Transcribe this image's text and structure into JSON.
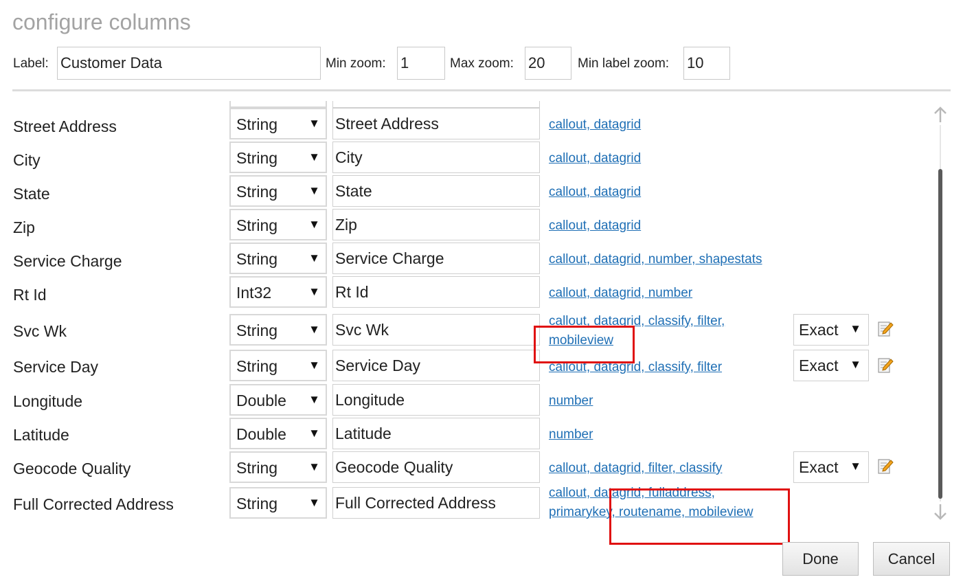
{
  "dialog": {
    "title": "configure columns"
  },
  "header": {
    "label_caption": "Label:",
    "label_value": "Customer Data",
    "min_zoom_caption": "Min zoom:",
    "min_zoom_value": "1",
    "max_zoom_caption": "Max zoom:",
    "max_zoom_value": "20",
    "min_label_zoom_caption": "Min label zoom:",
    "min_label_zoom_value": "10"
  },
  "columns": [
    {
      "name": "Street Address",
      "type": "String",
      "alias": "Street Address",
      "uses": "callout, datagrid"
    },
    {
      "name": "City",
      "type": "String",
      "alias": "City",
      "uses": "callout, datagrid"
    },
    {
      "name": "State",
      "type": "String",
      "alias": "State",
      "uses": "callout, datagrid"
    },
    {
      "name": "Zip",
      "type": "String",
      "alias": "Zip",
      "uses": "callout, datagrid"
    },
    {
      "name": "Service Charge",
      "type": "String",
      "alias": "Service Charge",
      "uses": "callout, datagrid, number, shapestats"
    },
    {
      "name": "Rt Id",
      "type": "Int32",
      "alias": "Rt Id",
      "uses": "callout, datagrid, number"
    },
    {
      "name": "Svc Wk",
      "type": "String",
      "alias": "Svc Wk",
      "uses_line1": "callout, datagrid, classify, filter,",
      "uses_line2": "mobileview",
      "match": "Exact"
    },
    {
      "name": "Service Day",
      "type": "String",
      "alias": "Service Day",
      "uses": "callout, datagrid, classify, filter",
      "match": "Exact"
    },
    {
      "name": "Longitude",
      "type": "Double",
      "alias": "Longitude",
      "uses": "number"
    },
    {
      "name": "Latitude",
      "type": "Double",
      "alias": "Latitude",
      "uses": "number"
    },
    {
      "name": "Geocode Quality",
      "type": "String",
      "alias": "Geocode Quality",
      "uses": "callout, datagrid, filter, classify",
      "match": "Exact"
    },
    {
      "name": "Full Corrected Address",
      "type": "String",
      "alias": "Full Corrected Address",
      "uses_line1": "callout, datagrid, fulladdress,",
      "uses_line2": "primarykey, routename, mobileview"
    }
  ],
  "icons": {
    "dropdown": "triangle-down-icon",
    "edit": "edit-pencil-icon",
    "scroll_up": "arrow-up-icon",
    "scroll_down": "arrow-down-icon"
  },
  "colors": {
    "link": "#1f6fb5",
    "highlight": "#e01010",
    "title": "#a3a3a3"
  },
  "buttons": {
    "done": "Done",
    "cancel": "Cancel"
  }
}
